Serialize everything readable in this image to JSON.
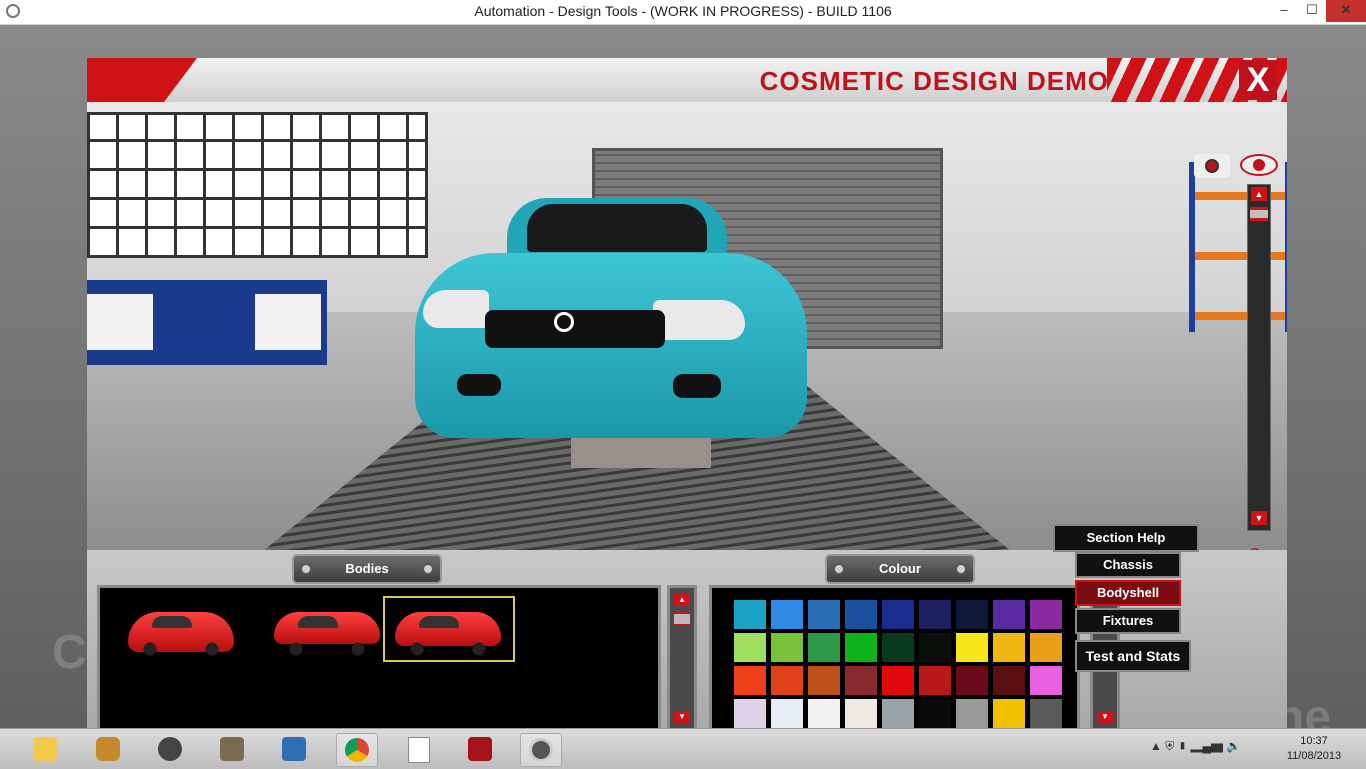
{
  "window": {
    "title": "Automation - Design Tools - (WORK IN PROGRESS) - BUILD 1106",
    "minimize_label": "–",
    "maximize_label": "☐",
    "close_label": "✕"
  },
  "header": {
    "title": "COSMETIC DESIGN DEMO",
    "close_label": "X"
  },
  "background_text": {
    "left": "C",
    "right": "ne"
  },
  "viewport": {
    "camera_icon": "camera-icon",
    "eye_icon": "eye-icon",
    "zoom_up_label": "▲",
    "zoom_down_label": "▼",
    "reset_view_label": "⊗"
  },
  "bodies": {
    "title": "Bodies",
    "items": [
      {
        "name": "hatchback"
      },
      {
        "name": "sedan"
      },
      {
        "name": "coupe",
        "selected": true
      }
    ]
  },
  "colour": {
    "title": "Colour",
    "swatches": [
      "#1aa3c4",
      "#2f8ae6",
      "#2a6fb5",
      "#1b4fa0",
      "#1a2e8f",
      "#1b1f5e",
      "#0f1a3a",
      "#5a2aa3",
      "#8a2aa0",
      "#a0e060",
      "#7ac23a",
      "#2e9a48",
      "#0eb21a",
      "#093a1e",
      "#0a0f0a",
      "#f5e51a",
      "#f0b612",
      "#e8a01a",
      "#f0401a",
      "#e0401a",
      "#c0501a",
      "#8a2a30",
      "#e00a0a",
      "#b81818",
      "#6a0a1a",
      "#5a1010",
      "#e860e0",
      "#e0d0e8",
      "#e8eef8",
      "#f2f2f2",
      "#eeeae0",
      "#98a4a8",
      "#0a0a0a",
      "#9a9a9a",
      "#f0c000",
      "#5a5a5a"
    ]
  },
  "menu": {
    "section_help": "Section Help",
    "chassis": "Chassis",
    "bodyshell": "Bodyshell",
    "fixtures": "Fixtures",
    "test_and_stats": "Test and Stats"
  },
  "taskbar": {
    "tray_icons": "▲ ⛨ ▮ ▂▄▆ 🔈",
    "time": "10:37",
    "date": "11/08/2013"
  }
}
